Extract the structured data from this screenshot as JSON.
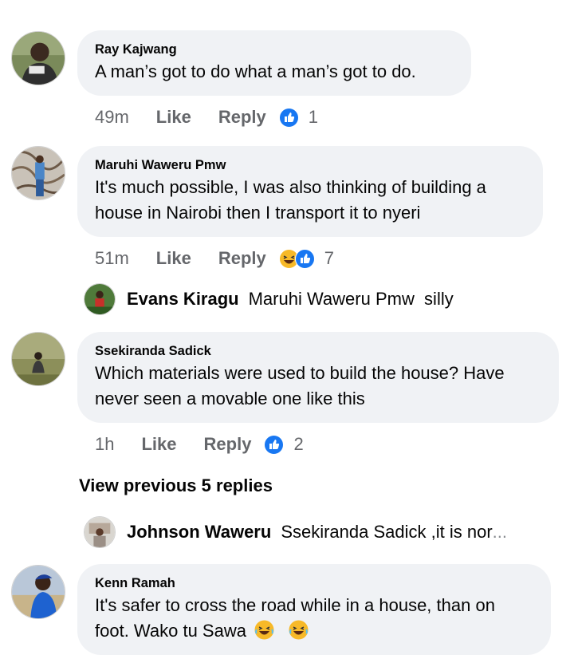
{
  "comments": [
    {
      "author": "Ray Kajwang",
      "text": "A man’s got to do what a man’s got to do.",
      "time": "49m",
      "like_label": "Like",
      "reply_label": "Reply",
      "reaction_count": "1",
      "reactions": [
        "like"
      ]
    },
    {
      "author": "Maruhi Waweru Pmw",
      "text_line1": "It's much possible, I was also thinking of building a",
      "text_line2": "house in Nairobi then I transport it to nyeri",
      "time": "51m",
      "like_label": "Like",
      "reply_label": "Reply",
      "reaction_count": "7",
      "reactions": [
        "haha",
        "like"
      ]
    },
    {
      "author": "Ssekiranda Sadick",
      "text_line1": "Which materials were used to build the house? Have",
      "text_line2": "never seen a movable one like this",
      "time": "1h",
      "like_label": "Like",
      "reply_label": "Reply",
      "reaction_count": "2",
      "reactions": [
        "like"
      ]
    },
    {
      "author": "Kenn Ramah",
      "text_line1": "It's safer to cross the road while in a house, than on",
      "text_line2": "foot. Wako tu Sawa",
      "emojis": [
        "haha",
        "haha"
      ]
    }
  ],
  "replies": [
    {
      "author": "Evans Kiragu",
      "text": "Maruhi Waweru Pmw  silly"
    },
    {
      "author": "Johnson Waweru",
      "text": "Ssekiranda Sadick ,it is nor",
      "ellipsis": "..."
    }
  ],
  "view_previous_label": "View previous 5 replies",
  "colors": {
    "bubble": "#f0f2f5",
    "meta_text": "#65676b",
    "like_blue": "#1877f2",
    "haha_yellow": "#f7b928"
  }
}
